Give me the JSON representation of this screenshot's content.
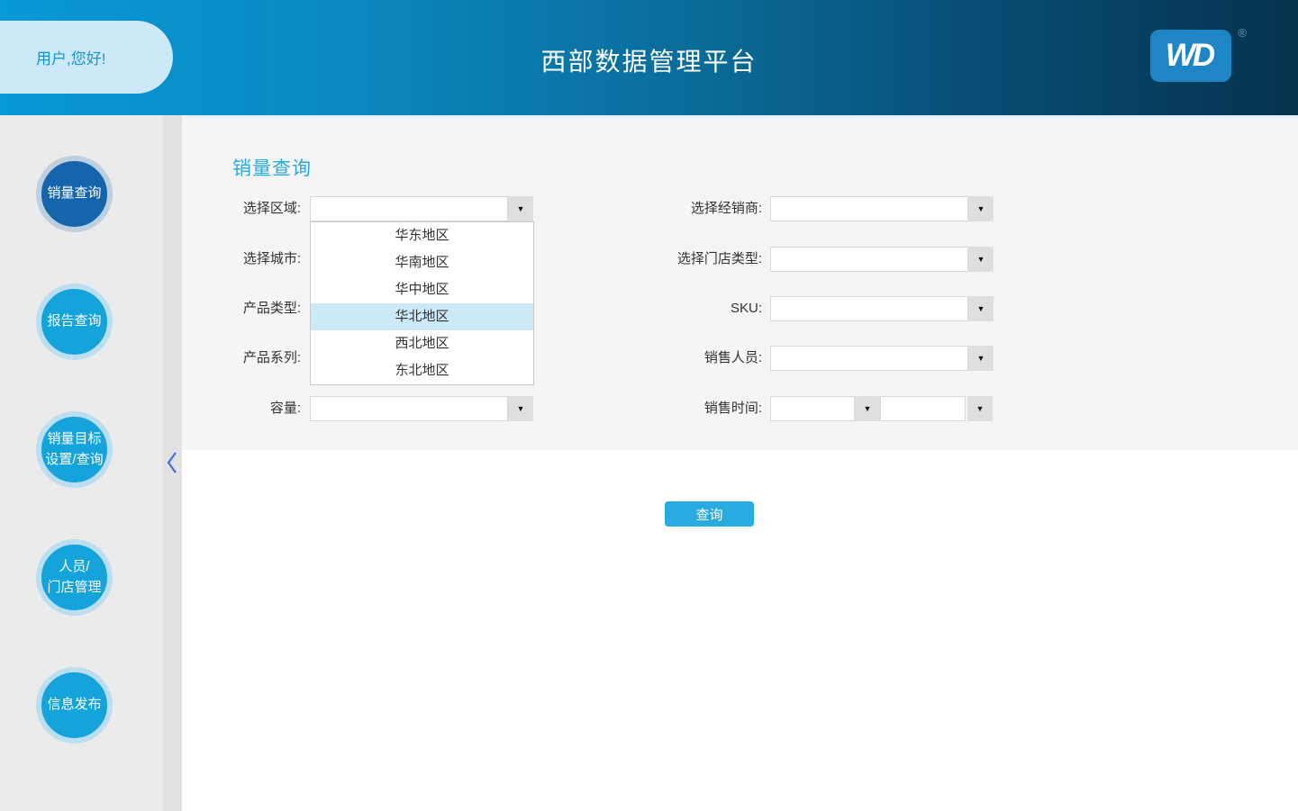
{
  "colors": {
    "accent": "#29ABE2",
    "header_gradient_start": "#0899D8",
    "header_gradient_end": "#06334E",
    "active_circle": "#1565AC",
    "circle": "#15A3DC",
    "dropdown_highlight": "#CBE9F7",
    "logo_blue": "#1E86C6",
    "greeting_pill": "#CDE8F6"
  },
  "header": {
    "greeting": "用户,您好!",
    "title": "西部数据管理平台",
    "logo_text": "WD",
    "registered_mark": "®"
  },
  "sidebar": {
    "items": [
      {
        "id": "sales-query",
        "label": "销量查询",
        "active": true
      },
      {
        "id": "report-query",
        "label": "报告查询",
        "active": false
      },
      {
        "id": "sales-target",
        "label": "销量目标\n设置/查询",
        "active": false
      },
      {
        "id": "staff-store-mgmt",
        "label": "人员/\n门店管理",
        "active": false
      },
      {
        "id": "info-publish",
        "label": "信息发布",
        "active": false
      }
    ]
  },
  "main": {
    "section_title": "销量查询",
    "query_button_label": "查询",
    "left_fields": [
      {
        "label": "选择区域:",
        "value": ""
      },
      {
        "label": "选择城市:",
        "value": ""
      },
      {
        "label": "产品类型:",
        "value": ""
      },
      {
        "label": "产品系列:",
        "value": ""
      },
      {
        "label": "容量:",
        "value": ""
      }
    ],
    "right_fields": [
      {
        "label": "选择经销商:",
        "value": ""
      },
      {
        "label": "选择门店类型:",
        "value": ""
      },
      {
        "label": "SKU:",
        "value": ""
      },
      {
        "label": "销售人员:",
        "value": ""
      },
      {
        "label": "销售时间:",
        "value_from": "",
        "value_to": ""
      }
    ],
    "region_dropdown": {
      "options": [
        "华东地区",
        "华南地区",
        "华中地区",
        "华北地区",
        "西北地区",
        "东北地区"
      ],
      "highlighted": "华北地区"
    }
  },
  "icons": {
    "dropdown_arrow": "▼"
  }
}
